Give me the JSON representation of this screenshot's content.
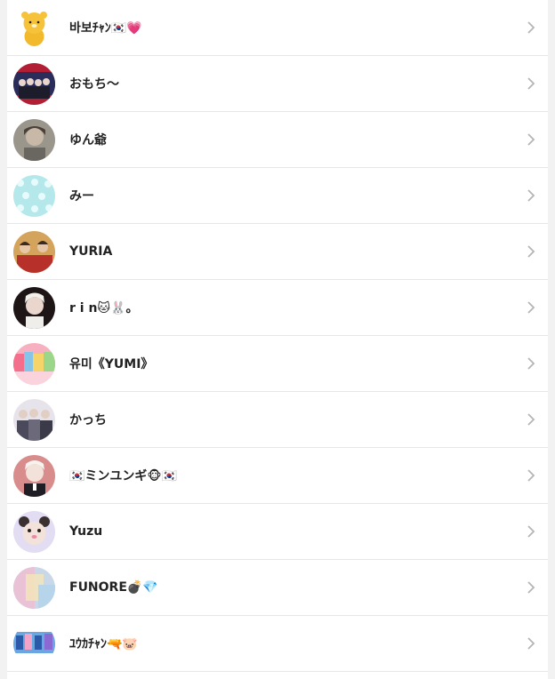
{
  "contacts": [
    {
      "name": "바보ﾁｬﾝ🇰🇷💗",
      "avatar": "character-bear-avatar",
      "color": "#f6c23a"
    },
    {
      "name": "おもち〜",
      "avatar": "group-photo-avatar",
      "color": "#3a3a6a"
    },
    {
      "name": "ゆん爺",
      "avatar": "portrait-avatar",
      "color": "#8a8a80"
    },
    {
      "name": "みー",
      "avatar": "pattern-avatar",
      "color": "#aee5e8"
    },
    {
      "name": "YURIA",
      "avatar": "group-photo-avatar",
      "color": "#b8433a"
    },
    {
      "name": "r i n🐱🐰。",
      "avatar": "portrait-avatar",
      "color": "#2a1e1e"
    },
    {
      "name": "유미《YUMI》",
      "avatar": "colorful-photo-avatar",
      "color": "#f3a3b3"
    },
    {
      "name": "かっち",
      "avatar": "group-photo-avatar",
      "color": "#6c6a7a"
    },
    {
      "name": "🇰🇷ミンユンギ🐵🇰🇷",
      "avatar": "portrait-avatar",
      "color": "#d98c8c"
    },
    {
      "name": "Yuzu",
      "avatar": "character-bear-avatar",
      "color": "#dcd6f0"
    },
    {
      "name": "FUNORE💣💎",
      "avatar": "pastel-photo-avatar",
      "color": "#c9b6d8"
    },
    {
      "name": "ﾕｳｶﾁｬﾝ🔫🐷",
      "avatar": "group-photo-avatar",
      "color": "#4a7fc9"
    }
  ]
}
